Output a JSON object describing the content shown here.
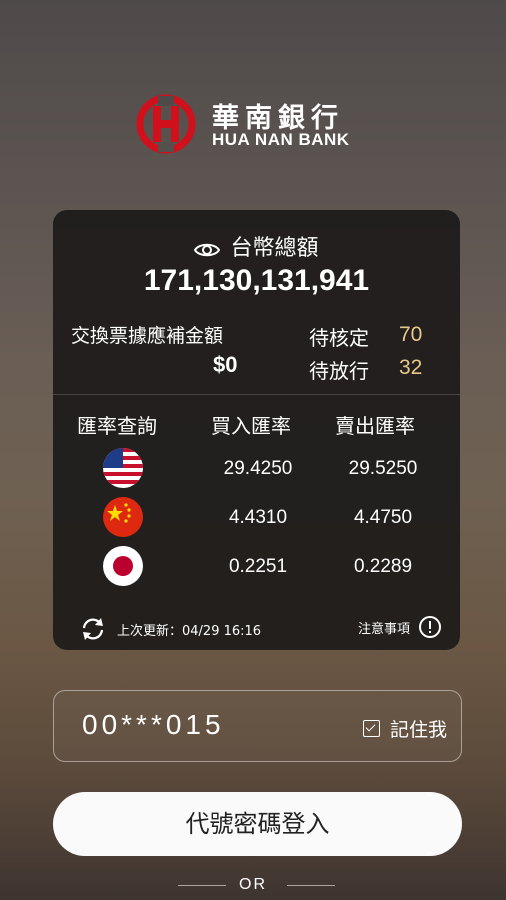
{
  "brand": {
    "name_cn": "華南銀行",
    "name_en": "HUA NAN BANK",
    "color": "#d0101b"
  },
  "balance": {
    "title": "台幣總額",
    "value": "171,130,131,941",
    "icon": "eye-icon"
  },
  "supplement": {
    "label": "交換票據應補金額",
    "value": "$0"
  },
  "pending": [
    {
      "label": "待核定",
      "value": "70"
    },
    {
      "label": "待放行",
      "value": "32"
    }
  ],
  "rates": {
    "headers": [
      "匯率查詢",
      "買入匯率",
      "賣出匯率"
    ],
    "rows": [
      {
        "currency_flag": "us-flag-icon",
        "buy": "29.4250",
        "sell": "29.5250"
      },
      {
        "currency_flag": "cn-flag-icon",
        "buy": "4.4310",
        "sell": "4.4750"
      },
      {
        "currency_flag": "jp-flag-icon",
        "buy": "0.2251",
        "sell": "0.2289"
      }
    ]
  },
  "update": {
    "text": "上次更新：04/29 16:16",
    "notice": "注意事項"
  },
  "login": {
    "account_value": "00***015",
    "remember_label": "記住我",
    "remember_checked": true,
    "button_label": "代號密碼登入",
    "or_text": "OR"
  },
  "colors": {
    "accent": "#e8c98a",
    "card_bg": "#1e1c1b"
  }
}
